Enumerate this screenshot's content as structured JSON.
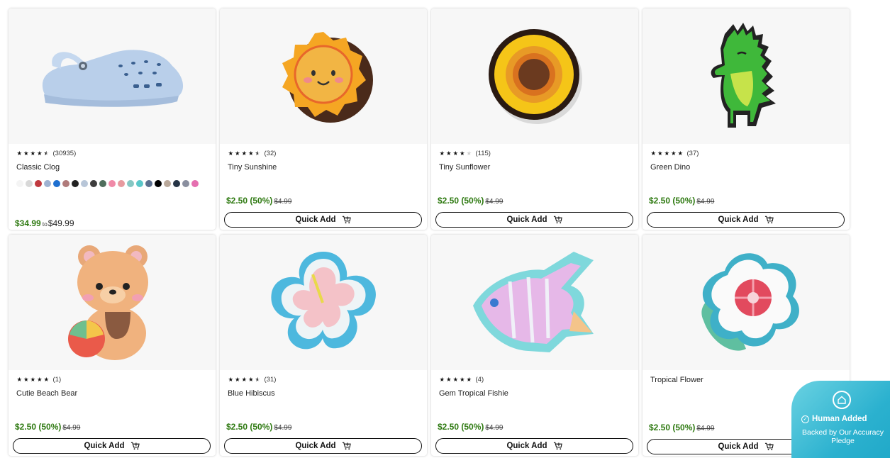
{
  "products": [
    {
      "name": "Classic Clog",
      "rating": 4.5,
      "count": "(30935)",
      "sale": "$34.99",
      "to": "to",
      "high": "$49.99",
      "has_swatches": true,
      "image": "classic-clog-image"
    },
    {
      "name": "Tiny Sunshine",
      "rating": 4.5,
      "count": "(32)",
      "sale": "$2.50 (50%)",
      "was": "$4.99",
      "quick_add": "Quick Add",
      "image": "tiny-sunshine-charm-image"
    },
    {
      "name": "Tiny Sunflower",
      "rating": 4,
      "count": "(115)",
      "sale": "$2.50 (50%)",
      "was": "$4.99",
      "quick_add": "Quick Add",
      "image": "tiny-sunflower-charm-image"
    },
    {
      "name": "Green Dino",
      "rating": 5,
      "count": "(37)",
      "sale": "$2.50 (50%)",
      "was": "$4.99",
      "quick_add": "Quick Add",
      "image": "green-dino-charm-image"
    },
    {
      "name": "Cutie Beach Bear",
      "rating": 5,
      "count": "(1)",
      "sale": "$2.50 (50%)",
      "was": "$4.99",
      "quick_add": "Quick Add",
      "image": "cutie-beach-bear-charm-image"
    },
    {
      "name": "Blue Hibiscus",
      "rating": 4.5,
      "count": "(31)",
      "sale": "$2.50 (50%)",
      "was": "$4.99",
      "quick_add": "Quick Add",
      "image": "blue-hibiscus-charm-image"
    },
    {
      "name": "Gem Tropical Fishie",
      "rating": 5,
      "count": "(4)",
      "sale": "$2.50 (50%)",
      "was": "$4.99",
      "quick_add": "Quick Add",
      "image": "gem-tropical-fishie-charm-image"
    },
    {
      "name": "Tropical Flower",
      "rating": null,
      "count": "",
      "sale": "$2.50 (50%)",
      "was": "$4.99",
      "quick_add": "Quick Add",
      "image": "tropical-flower-charm-image"
    }
  ],
  "swatch_colors": [
    "#f4f4f4",
    "#d8d8d8",
    "#c0393f",
    "#9fb3d2",
    "#1e6fd0",
    "#b07b7b",
    "#222222",
    "#b8c6d8",
    "#3d3d3d",
    "#4f6e5c",
    "#f08aa8",
    "#e79a9f",
    "#86c7c3",
    "#5bc7c9",
    "#5c6f8e",
    "#000000",
    "#b9a89a",
    "#263446",
    "#8a8f9f",
    "#e56fb0"
  ],
  "badge": {
    "title": "Human Added",
    "subtitle": "Backed by Our Accuracy Pledge"
  },
  "colors": {
    "sale": "#2f7a12",
    "badge": "#2bb1cf"
  }
}
